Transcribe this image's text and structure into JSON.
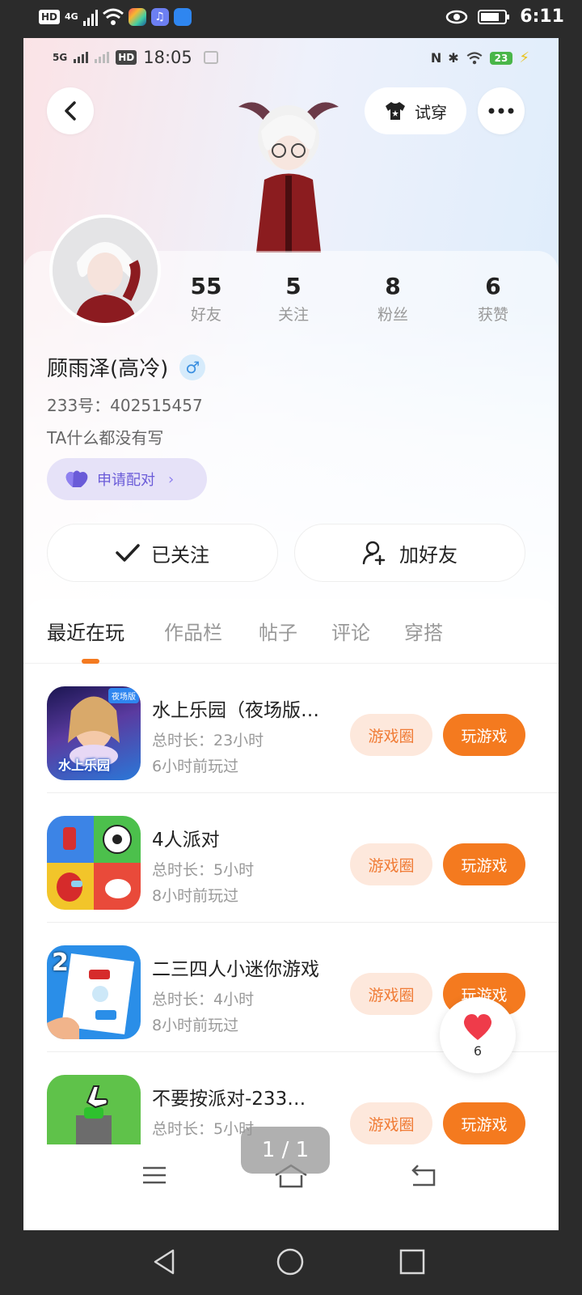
{
  "outer_status": {
    "network": "4G",
    "hd": "HD",
    "time": "6:11"
  },
  "inner_status": {
    "network": "5G",
    "hd": "HD",
    "time": "18:05",
    "battery": "23"
  },
  "header": {
    "try_on_label": "试穿"
  },
  "stats": [
    {
      "num": "55",
      "label": "好友"
    },
    {
      "num": "5",
      "label": "关注"
    },
    {
      "num": "8",
      "label": "粉丝"
    },
    {
      "num": "6",
      "label": "获赞"
    }
  ],
  "profile": {
    "name": "顾雨泽(高冷)",
    "gender_symbol": "♂",
    "uid": "233号：402515457",
    "bio": "TA什么都没有写",
    "pair_label": "申请配对"
  },
  "actions": {
    "follow_label": "已关注",
    "add_friend_label": "加好友"
  },
  "tabs": [
    "最近在玩",
    "作品栏",
    "帖子",
    "评论",
    "穿搭"
  ],
  "games": [
    {
      "title": "水上乐园（夜场版…",
      "duration": "总时长：23小时",
      "last": "6小时前玩过",
      "icon_text": "水上乐园",
      "icon_badge": "夜场版"
    },
    {
      "title": "4人派对",
      "duration": "总时长：5小时",
      "last": "8小时前玩过"
    },
    {
      "title": "二三四人小迷你游戏",
      "duration": "总时长：4小时",
      "last": "8小时前玩过",
      "icon_num": "2"
    },
    {
      "title": "不要按派对-233…",
      "duration": "总时长：5小时",
      "last": ""
    }
  ],
  "game_circle_label": "游戏圈",
  "play_label": "玩游戏",
  "like_count": "6",
  "page_indicator": "1 / 1",
  "colors": {
    "accent": "#f47a1f",
    "accent_light": "#fde8dc",
    "pair_purple": "#6a5bd8"
  }
}
